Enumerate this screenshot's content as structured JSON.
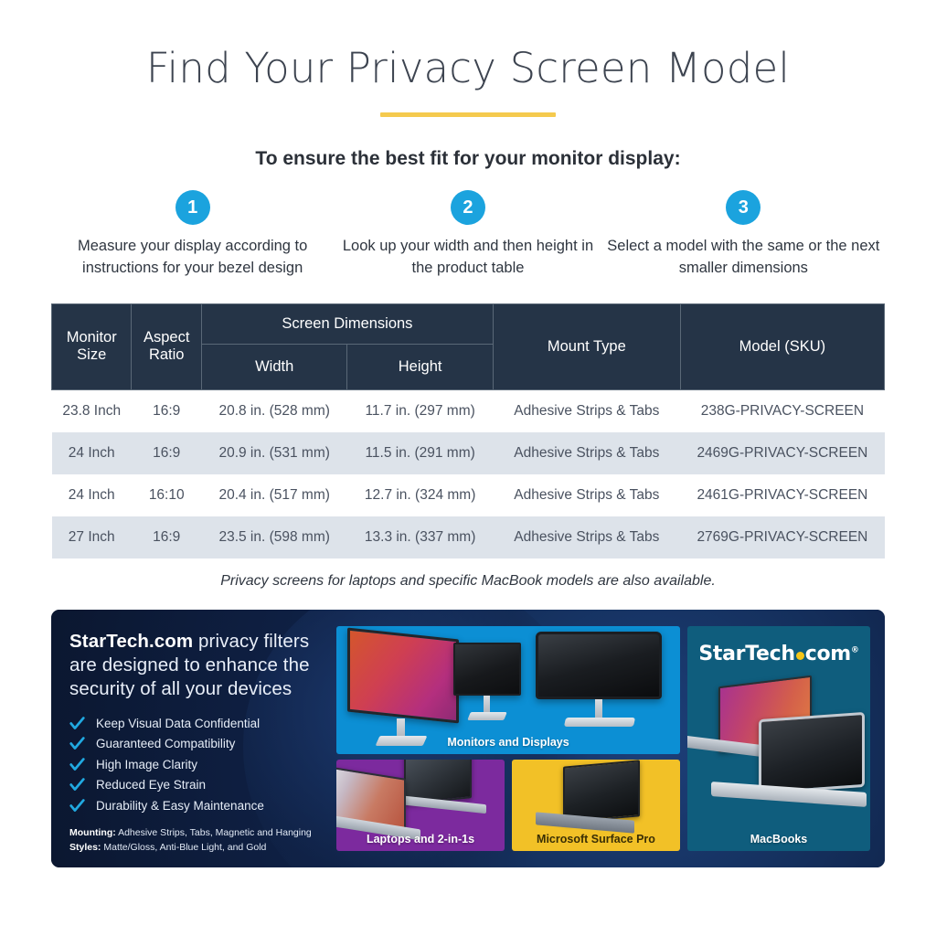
{
  "header": {
    "title": "Find Your Privacy Screen Model",
    "subtitle": "To ensure the best fit for your monitor display:",
    "accent_color": "#f5ca4e"
  },
  "steps": [
    {
      "number": "1",
      "text": "Measure your display according to instructions for your bezel design"
    },
    {
      "number": "2",
      "text": "Look up your width and then height in the product table"
    },
    {
      "number": "3",
      "text": "Select a model with the same or the next smaller dimensions"
    }
  ],
  "step_badge_color": "#1ba3de",
  "table": {
    "group_header": "Screen Dimensions",
    "headers": {
      "monitor_size": "Monitor Size",
      "aspect_ratio": "Aspect Ratio",
      "width": "Width",
      "height": "Height",
      "mount_type": "Mount Type",
      "model_sku": "Model (SKU)"
    },
    "header_bg": "#253447",
    "alt_row_bg": "#dde3ea",
    "rows": [
      {
        "monitor_size": "23.8 Inch",
        "aspect_ratio": "16:9",
        "width": "20.8 in. (528 mm)",
        "height": "11.7 in. (297 mm)",
        "mount_type": "Adhesive Strips & Tabs",
        "model_sku": "238G-PRIVACY-SCREEN"
      },
      {
        "monitor_size": "24 Inch",
        "aspect_ratio": "16:9",
        "width": "20.9 in. (531 mm)",
        "height": "11.5 in. (291 mm)",
        "mount_type": "Adhesive Strips & Tabs",
        "model_sku": "2469G-PRIVACY-SCREEN"
      },
      {
        "monitor_size": "24 Inch",
        "aspect_ratio": "16:10",
        "width": "20.4 in. (517 mm)",
        "height": "12.7 in. (324 mm)",
        "mount_type": "Adhesive Strips & Tabs",
        "model_sku": "2461G-PRIVACY-SCREEN"
      },
      {
        "monitor_size": "27 Inch",
        "aspect_ratio": "16:9",
        "width": "23.5 in. (598 mm)",
        "height": "13.3 in. (337 mm)",
        "mount_type": "Adhesive Strips & Tabs",
        "model_sku": "2769G-PRIVACY-SCREEN"
      }
    ],
    "note": "Privacy screens for laptops and specific MacBook models are also available."
  },
  "banner": {
    "headline_brand": "StarTech.com",
    "headline_rest": " privacy filters are designed  to enhance the security of all your devices",
    "features": [
      "Keep Visual Data Confidential",
      "Guaranteed Compatibility",
      "High Image Clarity",
      "Reduced Eye Strain",
      "Durability & Easy Maintenance"
    ],
    "check_color": "#21a9e1",
    "mounting_label": "Mounting:",
    "mounting_value": " Adhesive Strips, Tabs, Magnetic and Hanging",
    "styles_label": "Styles:",
    "styles_value": " Matte/Gloss, Anti-Blue Light, and Gold",
    "panels": {
      "monitors": {
        "label": "Monitors and Displays",
        "bg": "#0c8fd4"
      },
      "laptops": {
        "label": "Laptops and 2-in-1s",
        "bg": "#7c2a9e"
      },
      "surface": {
        "label": "Microsoft Surface Pro",
        "bg": "#f2c127"
      },
      "macbooks": {
        "label": "MacBooks",
        "bg": "#0f5d7d"
      }
    },
    "logo": {
      "part1": "StarTech",
      "part2": "com",
      "registered": "®"
    }
  }
}
